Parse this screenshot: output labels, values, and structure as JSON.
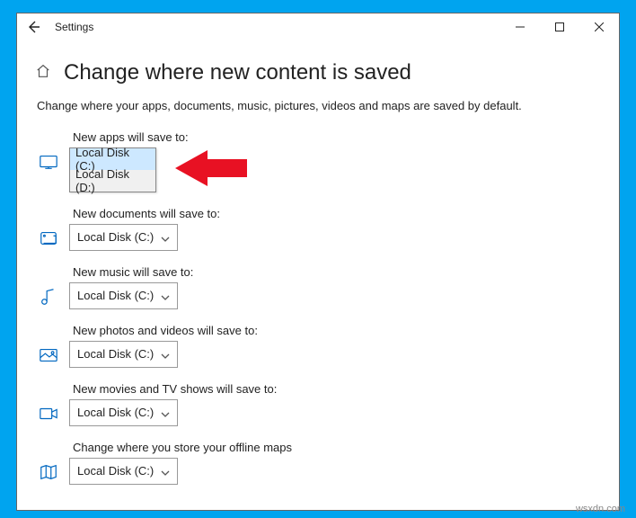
{
  "titlebar": {
    "app_title": "Settings"
  },
  "header": {
    "page_title": "Change where new content is saved"
  },
  "description": "Change where your apps, documents, music, pictures, videos and maps are saved by default.",
  "groups": {
    "apps": {
      "label": "New apps will save to:",
      "selected": "Local Disk (C:)",
      "options": [
        "Local Disk (C:)",
        "Local Disk (D:)"
      ]
    },
    "docs": {
      "label": "New documents will save to:",
      "selected": "Local Disk (C:)"
    },
    "music": {
      "label": "New music will save to:",
      "selected": "Local Disk (C:)"
    },
    "photos": {
      "label": "New photos and videos will save to:",
      "selected": "Local Disk (C:)"
    },
    "movies": {
      "label": "New movies and TV shows will save to:",
      "selected": "Local Disk (C:)"
    },
    "maps": {
      "label": "Change where you store your offline maps",
      "selected": "Local Disk (C:)"
    }
  },
  "watermark": "wsxdn.com",
  "colors": {
    "accent": "#0067c0",
    "danger": "#e81123",
    "desktop": "#00a4ef"
  }
}
